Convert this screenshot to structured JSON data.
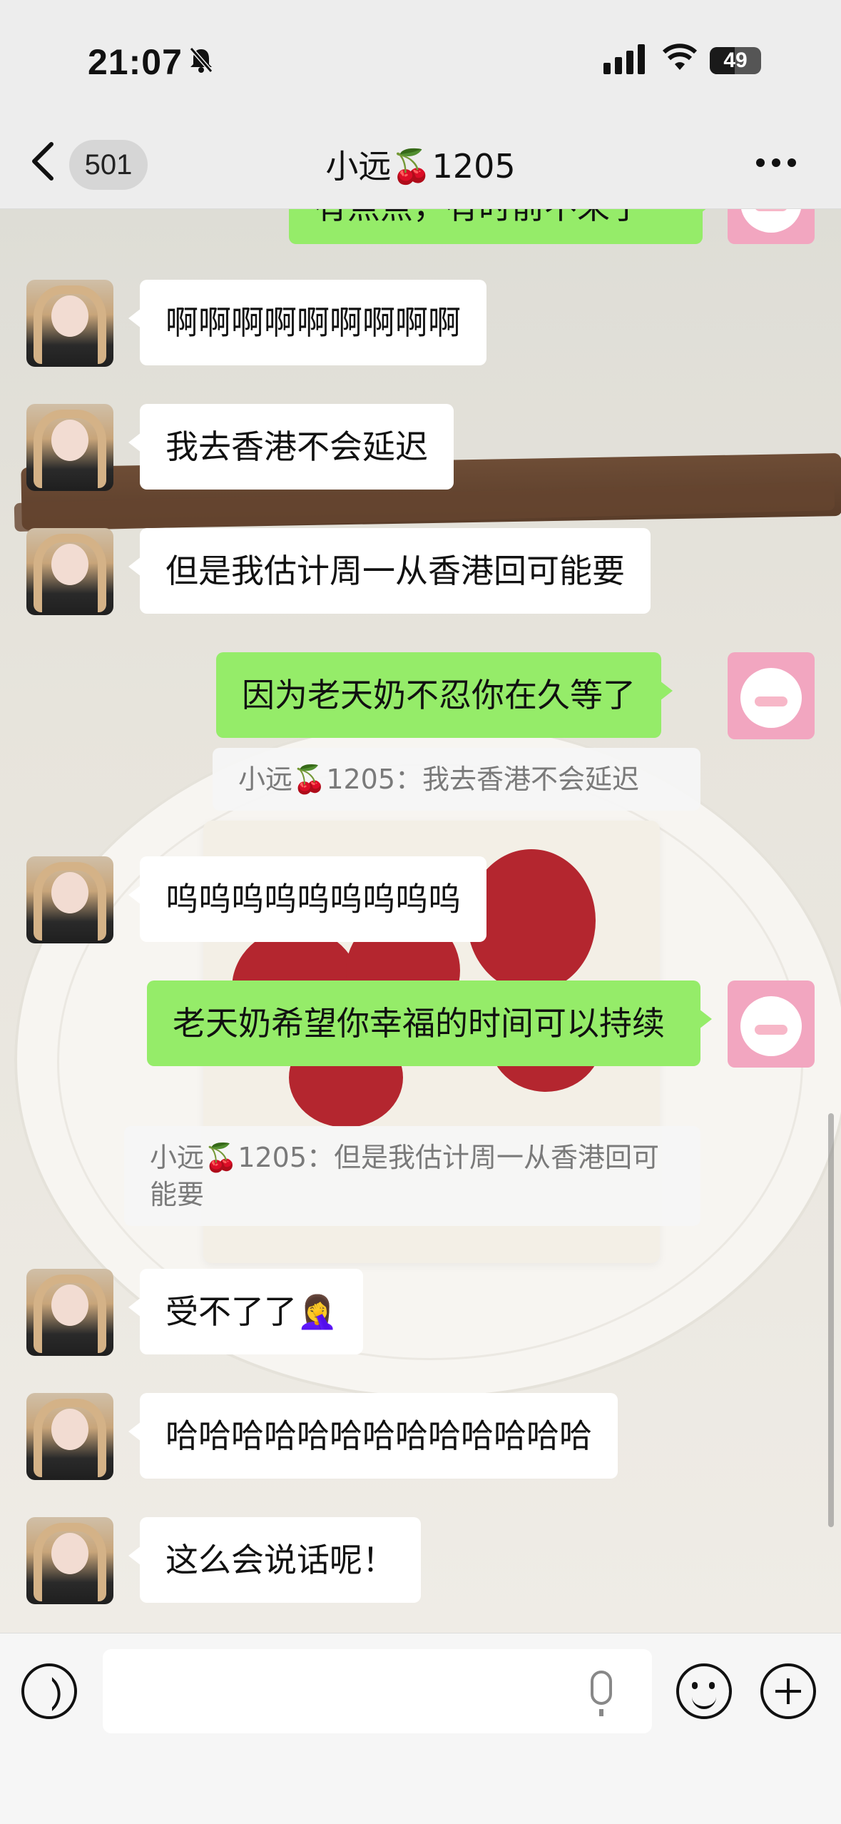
{
  "status_bar": {
    "time": "21:07",
    "battery": "49",
    "battery_level": 0.49,
    "icons": [
      "bell-muted-icon",
      "signal-icon",
      "wifi-icon",
      "battery-icon"
    ]
  },
  "nav": {
    "unread_count": "501",
    "title": "小远🍒1205",
    "back_icon": "chevron-left-icon",
    "more_icon": "more-dots-icon"
  },
  "messages": [
    {
      "from": "me",
      "text": "有点点，有时前不来了"
    },
    {
      "from": "her",
      "text": "啊啊啊啊啊啊啊啊啊"
    },
    {
      "from": "her",
      "text": "我去香港不会延迟"
    },
    {
      "from": "her",
      "text": "但是我估计周一从香港回可能要"
    },
    {
      "from": "me",
      "text": "因为老天奶不忍你在久等了",
      "quote": "小远🍒1205：我去香港不会延迟"
    },
    {
      "from": "her",
      "text": "呜呜呜呜呜呜呜呜呜"
    },
    {
      "from": "me",
      "text": "老天奶希望你幸福的时间可以持续",
      "quote": "小远🍒1205：但是我估计周一从香港回可能要"
    },
    {
      "from": "her",
      "text": "受不了了🤦‍♀️"
    },
    {
      "from": "her",
      "text": "哈哈哈哈哈哈哈哈哈哈哈哈哈"
    },
    {
      "from": "her",
      "text": "这么会说话呢！"
    }
  ],
  "input": {
    "placeholder": "",
    "value": ""
  },
  "colors": {
    "outgoing_bubble": "#95ec69",
    "incoming_bubble": "#ffffff",
    "bar_bg": "#ededed"
  }
}
